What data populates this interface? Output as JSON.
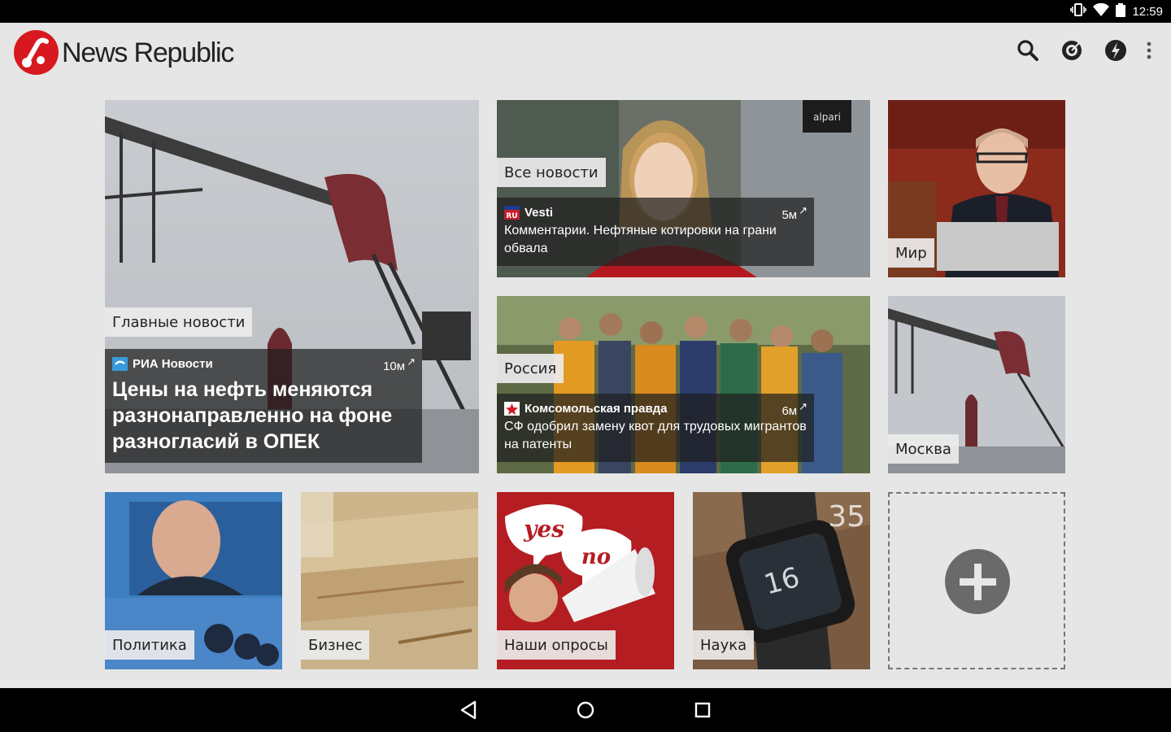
{
  "status_bar": {
    "time": "12:59",
    "icons": [
      "vibrate-icon",
      "wifi-icon",
      "battery-icon"
    ]
  },
  "app": {
    "name": "News Republic",
    "actions": [
      "search-icon",
      "radar-icon",
      "flash-icon",
      "overflow-menu-icon"
    ],
    "accent": "#d7181f"
  },
  "tiles": {
    "main": {
      "category": "Главные новости",
      "source": "РИА Новости",
      "time": "10м",
      "headline": "Цены на нефть меняются разнонаправленно на фоне разногласий в ОПЕК"
    },
    "all_news": {
      "category": "Все новости",
      "source": "Vesti",
      "source_badge": "RU",
      "time": "5м",
      "headline": "Комментарии. Нефтяные котировки на грани обвала",
      "watermark": "alpari"
    },
    "world": {
      "category": "Мир"
    },
    "russia": {
      "category": "Россия",
      "source": "Комсомольская правда",
      "time": "6м",
      "headline": "СФ одобрил замену квот для трудовых мигрантов на патенты"
    },
    "moscow": {
      "category": "Москва"
    },
    "politics": {
      "category": "Политика"
    },
    "business": {
      "category": "Бизнес"
    },
    "polls": {
      "category": "Наши опросы",
      "bubble_yes": "yes",
      "bubble_no": "no"
    },
    "science": {
      "category": "Наука",
      "watch_digits": "16",
      "corner_number": "35"
    },
    "add": {
      "icon": "add-icon"
    }
  },
  "nav_bar": {
    "buttons": [
      "back-icon",
      "home-icon",
      "recents-icon"
    ]
  }
}
